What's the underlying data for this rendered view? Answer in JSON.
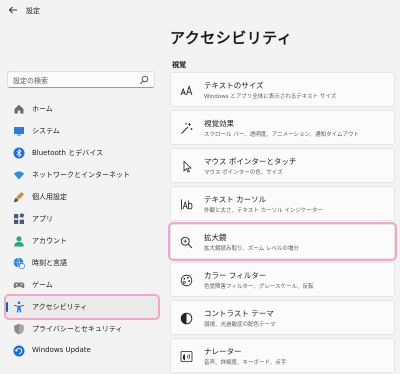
{
  "window": {
    "title": "設定"
  },
  "page": {
    "title": "アクセシビリティ"
  },
  "search": {
    "placeholder": "設定の検索"
  },
  "sidebar": {
    "items": [
      {
        "label": "ホーム",
        "icon": "home-icon",
        "color": "#555555"
      },
      {
        "label": "システム",
        "icon": "monitor-icon",
        "color": "#2a7fd4"
      },
      {
        "label": "Bluetooth とデバイス",
        "icon": "bluetooth-icon",
        "color": "#1e6fd0"
      },
      {
        "label": "ネットワークとインターネット",
        "icon": "wifi-icon",
        "color": "#2a8fdd"
      },
      {
        "label": "個人用設定",
        "icon": "brush-icon",
        "color": "#d08a3a"
      },
      {
        "label": "アプリ",
        "icon": "apps-icon",
        "color": "#4b5b7a"
      },
      {
        "label": "アカウント",
        "icon": "person-icon",
        "color": "#2aa58a"
      },
      {
        "label": "時刻と言語",
        "icon": "globe-clock-icon",
        "color": "#2a7fd4"
      },
      {
        "label": "ゲーム",
        "icon": "gamepad-icon",
        "color": "#7a7a7a"
      },
      {
        "label": "アクセシビリティ",
        "icon": "accessibility-icon",
        "color": "#1e6fd0",
        "selected": true
      },
      {
        "label": "プライバシーとセキュリティ",
        "icon": "shield-icon",
        "color": "#8a8a8a"
      },
      {
        "label": "Windows Update",
        "icon": "update-icon",
        "color": "#1e6fd0"
      }
    ]
  },
  "section": {
    "label": "視覚"
  },
  "cards": [
    {
      "title": "テキストのサイズ",
      "desc": "Windows とアプリ全体に表示されるテキスト サイズ",
      "icon": "text-size-icon"
    },
    {
      "title": "視覚効果",
      "desc": "スクロール バー、透明度、アニメーション、通知タイムアウト",
      "icon": "sparkle-icon"
    },
    {
      "title": "マウス ポインターとタッチ",
      "desc": "マウス ポインターの色、サイズ",
      "icon": "pointer-icon"
    },
    {
      "title": "テキスト カーソル",
      "desc": "外観と太さ、テキスト カーソル インジケーター",
      "icon": "text-cursor-icon"
    },
    {
      "title": "拡大鏡",
      "desc": "拡大鏡読み取り、ズーム レベルの増分",
      "icon": "magnifier-icon",
      "highlight": true
    },
    {
      "title": "カラー フィルター",
      "desc": "色覚障害フィルター、グレースケール、反転",
      "icon": "color-filter-icon"
    },
    {
      "title": "コントラスト テーマ",
      "desc": "弱視、光過敏症の配色テーマ",
      "icon": "contrast-icon"
    },
    {
      "title": "ナレーター",
      "desc": "音声、詳細度、キーボード、点字",
      "icon": "narrator-icon"
    }
  ]
}
